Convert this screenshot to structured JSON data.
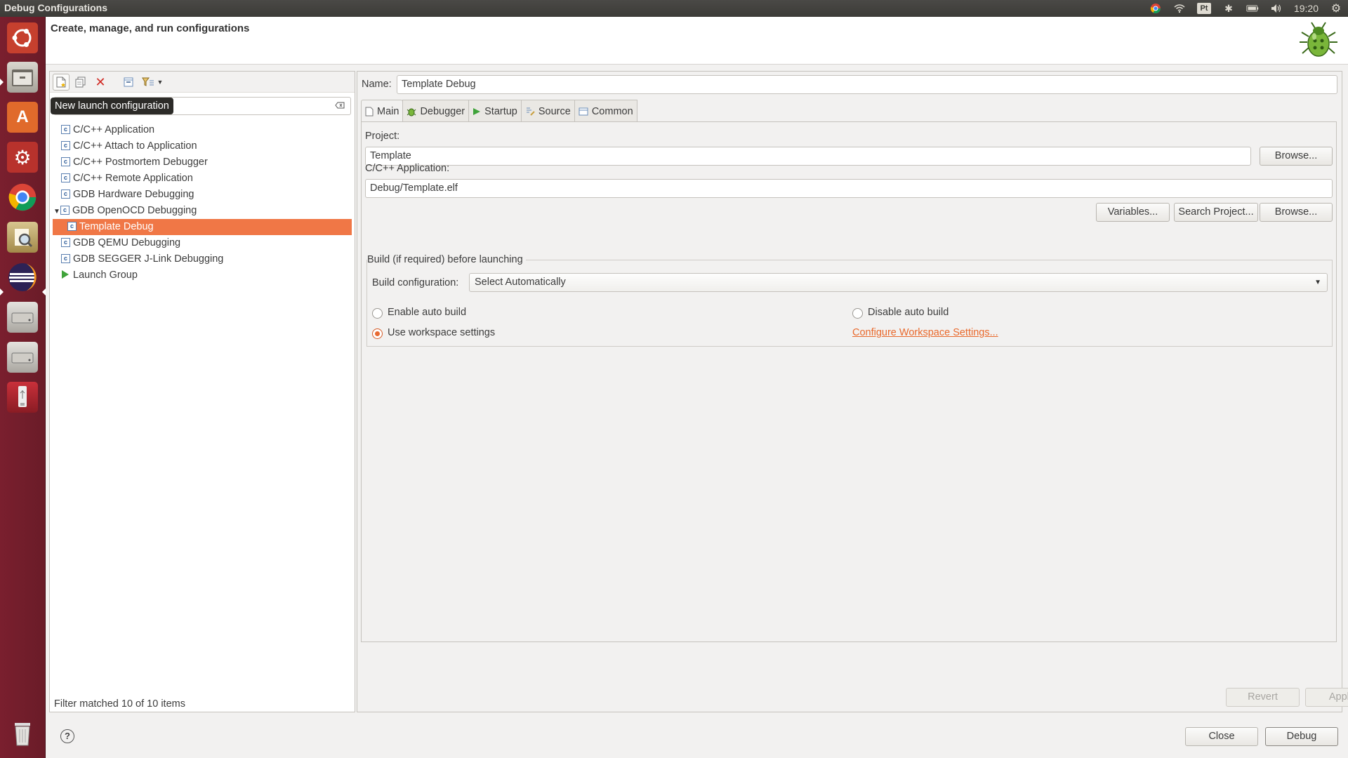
{
  "topbar": {
    "title": "Debug Configurations",
    "keyboard": "Pt",
    "clock": "19:20"
  },
  "launcher": {
    "items": [
      "ubuntu-dash",
      "files",
      "software-center",
      "system-settings",
      "chrome",
      "text-editor",
      "eclipse",
      "disk-1",
      "disk-2",
      "usb-drive",
      "trash"
    ]
  },
  "header": {
    "title": "Create, manage, and run configurations"
  },
  "left": {
    "tooltip": "New launch configuration",
    "filter_placeholder": "",
    "tree": [
      {
        "label": "C/C++ Application",
        "type": "config",
        "level": 0
      },
      {
        "label": "C/C++ Attach to Application",
        "type": "config",
        "level": 0
      },
      {
        "label": "C/C++ Postmortem Debugger",
        "type": "config",
        "level": 0
      },
      {
        "label": "C/C++ Remote Application",
        "type": "config",
        "level": 0
      },
      {
        "label": "GDB Hardware Debugging",
        "type": "config",
        "level": 0
      },
      {
        "label": "GDB OpenOCD Debugging",
        "type": "config",
        "level": 0,
        "expanded": true
      },
      {
        "label": "Template Debug",
        "type": "config",
        "level": 1,
        "selected": true
      },
      {
        "label": "GDB QEMU Debugging",
        "type": "config",
        "level": 0
      },
      {
        "label": "GDB SEGGER J-Link Debugging",
        "type": "config",
        "level": 0
      },
      {
        "label": "Launch Group",
        "type": "group",
        "level": 0
      }
    ],
    "status": "Filter matched 10 of 10 items"
  },
  "right": {
    "name_label": "Name:",
    "name_value": "Template Debug",
    "tabs": [
      {
        "label": "Main",
        "icon": "page-icon",
        "active": true
      },
      {
        "label": "Debugger",
        "icon": "bug-icon"
      },
      {
        "label": "Startup",
        "icon": "play-icon"
      },
      {
        "label": "Source",
        "icon": "source-icon"
      },
      {
        "label": "Common",
        "icon": "common-icon"
      }
    ],
    "project_label": "Project:",
    "project_value": "Template",
    "browse": "Browse...",
    "app_label": "C/C++ Application:",
    "app_value": "Debug/Template.elf",
    "variables": "Variables...",
    "search_project": "Search Project...",
    "build_group_title": "Build (if required) before launching",
    "build_config_label": "Build configuration:",
    "build_config_value": "Select Automatically",
    "enable_auto_build": "Enable auto build",
    "disable_auto_build": "Disable auto build",
    "use_workspace": "Use workspace settings",
    "configure_workspace": "Configure Workspace Settings...",
    "selected_radio": "use_workspace",
    "revert": "Revert",
    "apply": "Apply"
  },
  "footer": {
    "help": "?",
    "close": "Close",
    "debug": "Debug"
  },
  "colors": {
    "accent": "#f07746",
    "launcher": "#7a1f2e",
    "link": "#e9692c"
  }
}
